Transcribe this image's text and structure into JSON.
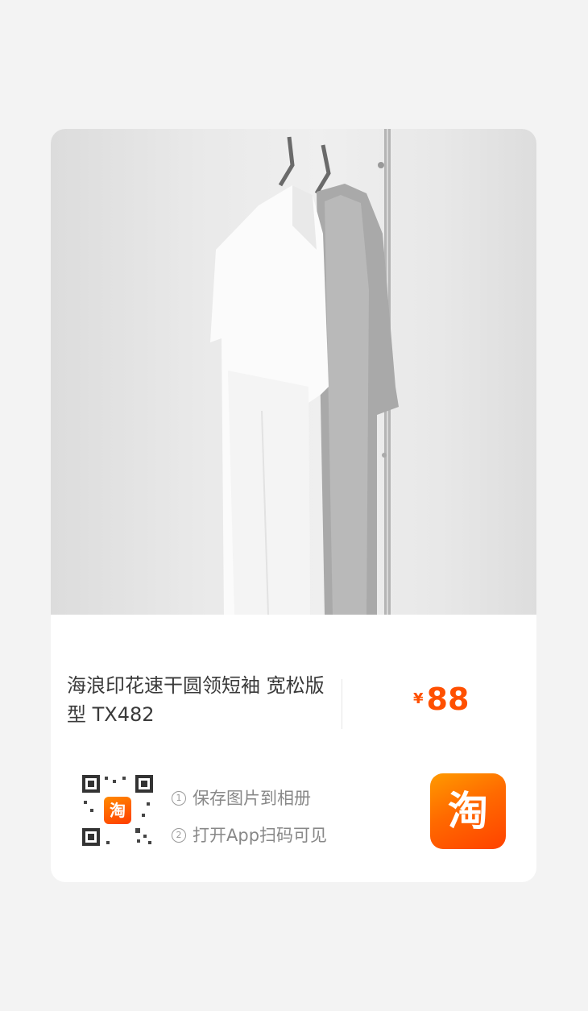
{
  "product": {
    "title": "海浪印花速干圆领短袖 宽松版型 TX482",
    "currency_symbol": "¥",
    "price": "88"
  },
  "share": {
    "steps": [
      {
        "number": "1",
        "text": "保存图片到相册"
      },
      {
        "number": "2",
        "text": "打开App扫码可见"
      }
    ],
    "qr_logo_char": "淘",
    "app_icon_char": "淘"
  },
  "colors": {
    "price": "#ff5000",
    "brand": "#ff5a00",
    "page_background": "#f3f3f3"
  },
  "icons": [
    "qr-code-icon",
    "taobao-app-icon"
  ]
}
